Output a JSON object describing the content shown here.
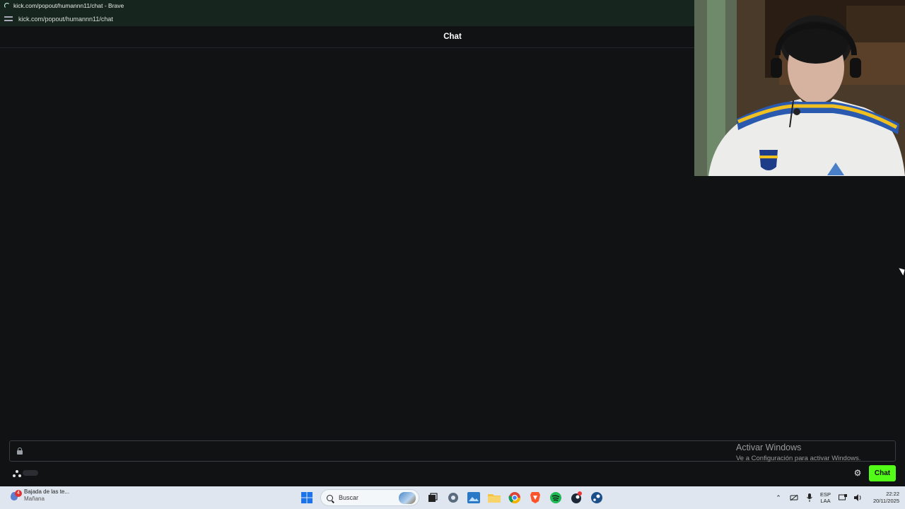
{
  "browser": {
    "window_title": "kick.com/popout/humannn11/chat - Brave",
    "url": "kick.com/popout/humannn11/chat"
  },
  "chat": {
    "header_title": "Chat",
    "input_placeholder": "",
    "send_button_label": "Chat"
  },
  "watermark": {
    "line1": "Activar Windows",
    "line2": "Ve a Configuración para activar Windows."
  },
  "taskbar": {
    "weather_badge": "4",
    "weather_title": "Bajada de las te...",
    "weather_subtitle": "Mañana",
    "search_placeholder": "Buscar",
    "pinned_icons": [
      "windows-start-icon",
      "task-view-icon",
      "settings-icon",
      "photos-icon",
      "file-explorer-icon",
      "chrome-icon",
      "brave-icon",
      "spotify-icon",
      "steam-notification-icon",
      "steam-icon"
    ],
    "language_line1": "ESP",
    "language_line2": "LAA",
    "time": "22:22",
    "date": "20/11/2025"
  },
  "colors": {
    "accent": "#53fc18",
    "browser_bar": "#16261f",
    "background": "#111214",
    "taskbar": "#dfe6ef"
  }
}
